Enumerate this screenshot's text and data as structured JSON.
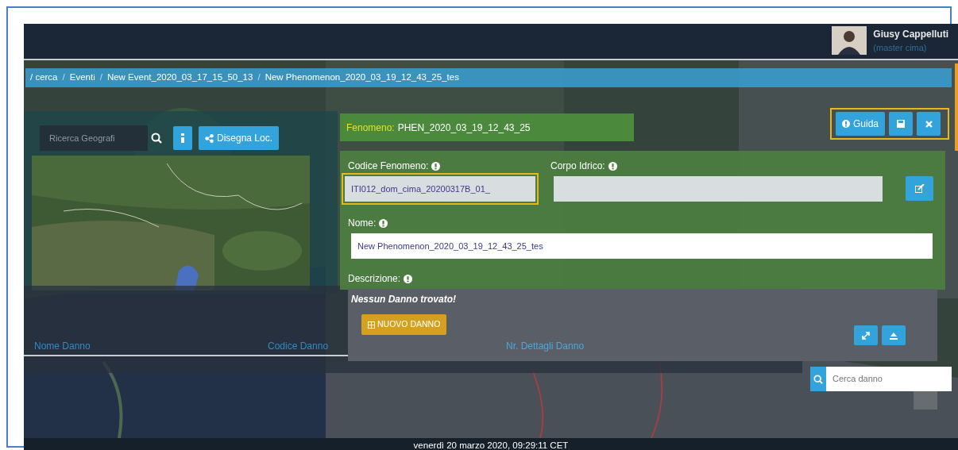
{
  "header": {
    "user_name": "Giusy Cappelluti",
    "user_role": "(master cima)"
  },
  "breadcrumb": [
    {
      "label": "/ cerca"
    },
    {
      "separator": "/",
      "label": "Eventi"
    },
    {
      "separator": "/",
      "label": "New Event_2020_03_17_15_50_13"
    },
    {
      "separator": "/",
      "label": "New Phenomenon_2020_03_19_12_43_25_tes"
    }
  ],
  "geo_panel": {
    "search_placeholder": "Ricerca Geografi",
    "draw_button": "Disegna Loc."
  },
  "phenomenon": {
    "label": "Fenomeno:",
    "value": "PHEN_2020_03_19_12_43_25"
  },
  "toolbar": {
    "help_button": "Guida",
    "highlighted": true
  },
  "form": {
    "fields": [
      {
        "label": "Codice Fenomeno:",
        "value": "ITI012_dom_cima_20200317B_01_",
        "highlighted": true
      },
      {
        "label": "Corpo Idrico:",
        "highlighted": false
      },
      {
        "label": "Nome:",
        "value": "New Phenomenon_2020_03_19_12_43_25_tes",
        "highlighted": false
      }
    ],
    "description_label": "Descrizione:"
  },
  "damages": {
    "empty_message": "Nessun Danno trovato!",
    "new_button": "NUOVO DANNO",
    "columns": [
      "Nome Danno",
      "Codice Danno",
      "Nr. Dettagli Danno"
    ],
    "search_placeholder": "Cerca danno"
  },
  "status_bar": "venerdì 20 marzo 2020, 09:29:11 CET"
}
